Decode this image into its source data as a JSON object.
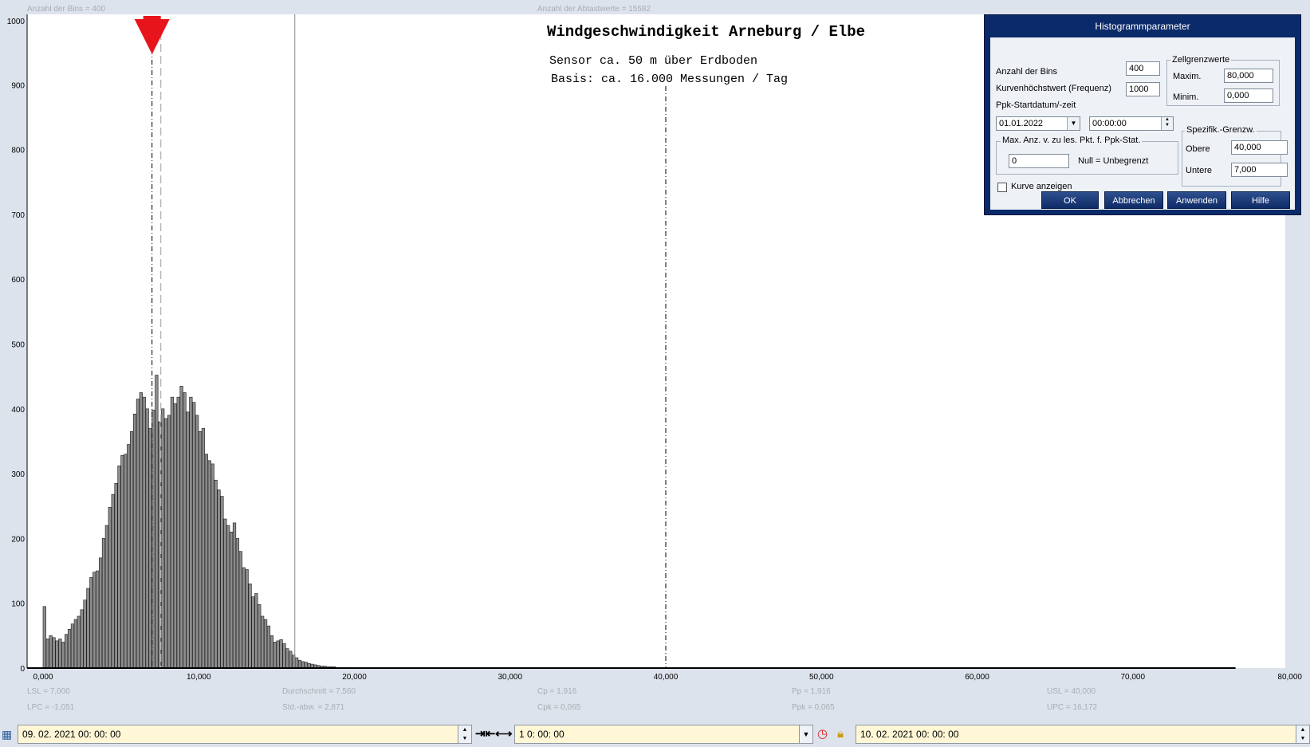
{
  "header": {
    "bins_info": "Anzahl der Bins =   400",
    "samples_info": "Anzahl der Abtastwerte = 15582"
  },
  "titles": {
    "main": "Windgeschwindigkeit  Arneburg / Elbe",
    "line1": "Sensor ca. 50 m über Erdboden",
    "line2": "Basis: ca. 16.000 Messungen / Tag"
  },
  "stats": {
    "lsl": "LSL = 7,000",
    "lpc": "LPC = -1,051",
    "mean": "Durchschnitt  = 7,560",
    "std": "Std.-abw. = 2,871",
    "cp": "Cp  = 1,916",
    "cpk": "Cpk = 0,065",
    "pp": "Pp  = 1,916",
    "ppk": "Ppk = 0,065",
    "usl": "USL = 40,000",
    "upc": "UPC = 16,172"
  },
  "chart_data": {
    "type": "bar",
    "title": "Windgeschwindigkeit  Arneburg / Elbe",
    "subtitle": [
      "Sensor ca. 50 m über Erdboden",
      "Basis: ca. 16.000 Messungen / Tag"
    ],
    "xlim": [
      0,
      80
    ],
    "ylim": [
      0,
      1000
    ],
    "xticks": [
      "0,000",
      "10,000",
      "20,000",
      "30,000",
      "40,000",
      "50,000",
      "60,000",
      "70,000",
      "80,000"
    ],
    "yticks": [
      "0",
      "100",
      "200",
      "300",
      "400",
      "500",
      "600",
      "700",
      "800",
      "900",
      "1000"
    ],
    "bin_width": 0.2,
    "x_start": 0,
    "values": [
      95,
      45,
      50,
      47,
      42,
      45,
      40,
      52,
      60,
      68,
      75,
      80,
      90,
      105,
      123,
      140,
      148,
      150,
      170,
      200,
      220,
      248,
      268,
      285,
      312,
      328,
      330,
      345,
      365,
      392,
      415,
      425,
      418,
      400,
      370,
      398,
      452,
      380,
      400,
      385,
      390,
      418,
      408,
      418,
      435,
      425,
      395,
      418,
      410,
      390,
      365,
      370,
      330,
      320,
      315,
      290,
      275,
      265,
      230,
      220,
      210,
      224,
      200,
      180,
      155,
      152,
      130,
      110,
      115,
      98,
      80,
      75,
      65,
      50,
      40,
      42,
      44,
      38,
      30,
      26,
      20,
      16,
      12,
      10,
      9,
      7,
      6,
      5,
      4,
      3,
      3,
      2,
      2,
      2,
      1,
      1,
      1,
      1,
      1,
      1,
      0,
      0,
      0,
      0,
      0,
      0,
      0,
      0,
      0,
      0,
      0,
      0,
      0,
      0,
      0,
      0,
      0,
      0,
      0,
      0,
      0,
      0,
      0,
      0,
      0,
      0,
      0,
      0,
      0,
      0,
      0,
      0,
      0,
      0,
      0,
      0,
      0,
      0,
      0,
      0,
      0,
      0,
      0,
      0,
      0,
      0,
      0,
      0,
      0,
      0,
      0,
      0,
      0,
      0,
      0,
      0,
      0,
      0,
      0,
      0,
      0,
      0,
      0,
      0,
      0,
      0,
      0,
      0,
      0,
      0,
      0,
      0,
      0,
      0,
      0,
      0,
      0,
      0,
      0,
      0,
      0,
      0,
      0,
      0,
      0,
      0,
      0,
      0,
      0,
      0,
      0,
      0,
      0,
      0,
      0,
      0,
      0,
      0,
      0,
      0,
      0,
      0,
      0,
      0,
      0,
      0,
      0,
      0,
      0,
      0,
      0,
      0,
      0,
      0,
      0,
      0,
      0,
      0,
      0,
      0,
      0,
      0,
      0,
      0,
      0,
      0,
      0,
      0,
      0,
      0,
      0,
      0,
      0,
      0,
      0,
      0,
      0,
      0,
      0,
      0,
      0,
      0,
      0,
      0,
      0,
      0,
      0,
      0,
      0,
      0,
      0,
      0,
      0,
      0,
      0,
      0,
      0,
      0,
      0,
      0,
      0,
      0,
      0,
      0,
      0,
      0,
      0,
      0,
      0,
      0,
      0,
      0,
      0,
      0,
      0,
      0,
      0,
      0,
      0,
      0,
      0,
      0,
      0,
      0,
      0,
      0,
      0,
      0,
      0,
      0,
      0,
      0,
      0,
      0,
      0,
      0,
      0,
      0,
      0,
      0,
      0,
      0,
      0,
      0,
      0,
      0,
      0,
      0,
      0,
      0,
      0,
      0,
      0,
      0,
      0,
      0,
      0,
      0,
      0,
      0,
      0,
      0,
      0,
      0,
      0,
      0,
      0,
      0,
      0,
      0,
      0,
      0,
      0,
      0,
      0,
      0,
      0,
      0,
      0,
      0,
      0,
      0,
      0,
      0,
      0,
      0,
      0,
      0,
      0,
      0,
      0,
      0,
      0,
      0,
      0,
      0,
      0,
      0,
      0,
      0,
      0,
      0,
      0,
      0,
      0,
      0,
      0,
      0,
      0,
      0,
      0,
      0,
      0,
      0,
      0,
      0,
      0,
      0,
      0,
      0,
      0,
      0,
      0,
      0,
      0,
      0,
      0,
      0,
      0,
      0,
      0,
      0,
      0,
      0,
      0,
      0,
      0,
      0,
      0,
      0,
      0,
      0,
      0,
      0,
      0,
      0,
      0,
      0,
      0,
      0,
      0,
      0
    ],
    "reference_lines": {
      "lsl": 7.0,
      "mean": 7.56,
      "upc": 16.172,
      "usl": 40.0
    },
    "marker_x": 7.0,
    "grid": false,
    "colors": {
      "bar_fill": "#8c8c8c",
      "bar_stroke": "#1a1a1a",
      "marker": "#e8141b",
      "axis": "#000000"
    }
  },
  "dialog": {
    "title": "Histogrammparameter",
    "bins_label": "Anzahl der Bins",
    "bins_value": "400",
    "peak_label": "Kurvenhöchstwert (Frequenz)",
    "peak_value": "1000",
    "ppk_start_label": "Ppk-Startdatum/-zeit",
    "date_value": "01.01.2022",
    "time_value": "00:00:00",
    "cell_limits_label": "Zellgrenzwerte",
    "max_label": "Maxim.",
    "max_value": "80,000",
    "min_label": "Minim.",
    "min_value": "0,000",
    "maxcount_label": "Max. Anz. v. zu les. Pkt. f. Ppk-Stat.",
    "maxcount_value": "0",
    "null_hint": "Null = Unbegrenzt",
    "spec_label": "Spezifik.-Grenzw.",
    "upper_label": "Obere",
    "upper_value": "40,000",
    "lower_label": "Untere",
    "lower_value": "7,000",
    "show_curve_label": "Kurve anzeigen",
    "show_curve_checked": false,
    "ok_label": "OK",
    "cancel_label": "Abbrechen",
    "apply_label": "Anwenden",
    "help_label": "Hilfe"
  },
  "bottombar": {
    "start_datetime": "09. 02. 2021   00: 00: 00",
    "interval": "1  0: 00: 00",
    "end_datetime": "10. 02. 2021   00: 00: 00",
    "calendar_icon": "calendar-icon",
    "shrink_icon": "arrows-inward-icon",
    "expand_icon": "arrows-outward-icon",
    "clock_icon": "clock-icon",
    "lock_icon": "lock-icon"
  }
}
